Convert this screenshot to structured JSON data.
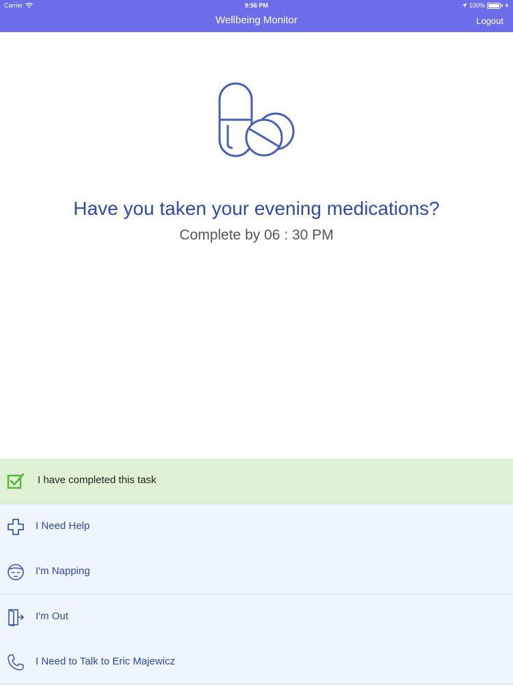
{
  "status_bar": {
    "carrier": "Carrier",
    "time": "9:56 PM",
    "battery": "100%"
  },
  "header": {
    "title": "Wellbeing Monitor",
    "logout_label": "Logout",
    "background_color": "#6b6ee8"
  },
  "task": {
    "icon": "pills-icon",
    "question": "Have you taken your evening medications?",
    "deadline": "Complete by 06 : 30 PM"
  },
  "options": [
    {
      "label": "I have completed this task",
      "icon": "checkbox-checked-icon",
      "color": "#dff2d6"
    },
    {
      "label": "I Need Help",
      "icon": "plus-cross-icon",
      "color": "#eef5fd"
    },
    {
      "label": "I'm Napping",
      "icon": "sleeping-face-icon",
      "color": "#eef5fd"
    },
    {
      "label": "I'm Out",
      "icon": "exit-door-icon",
      "color": "#eef5fd"
    },
    {
      "label": "I Need to Talk to Eric Majewicz",
      "icon": "phone-icon",
      "color": "#eef5fd"
    }
  ],
  "colors": {
    "accent": "#2f4aa6",
    "completed_green": "#5ab53c"
  }
}
